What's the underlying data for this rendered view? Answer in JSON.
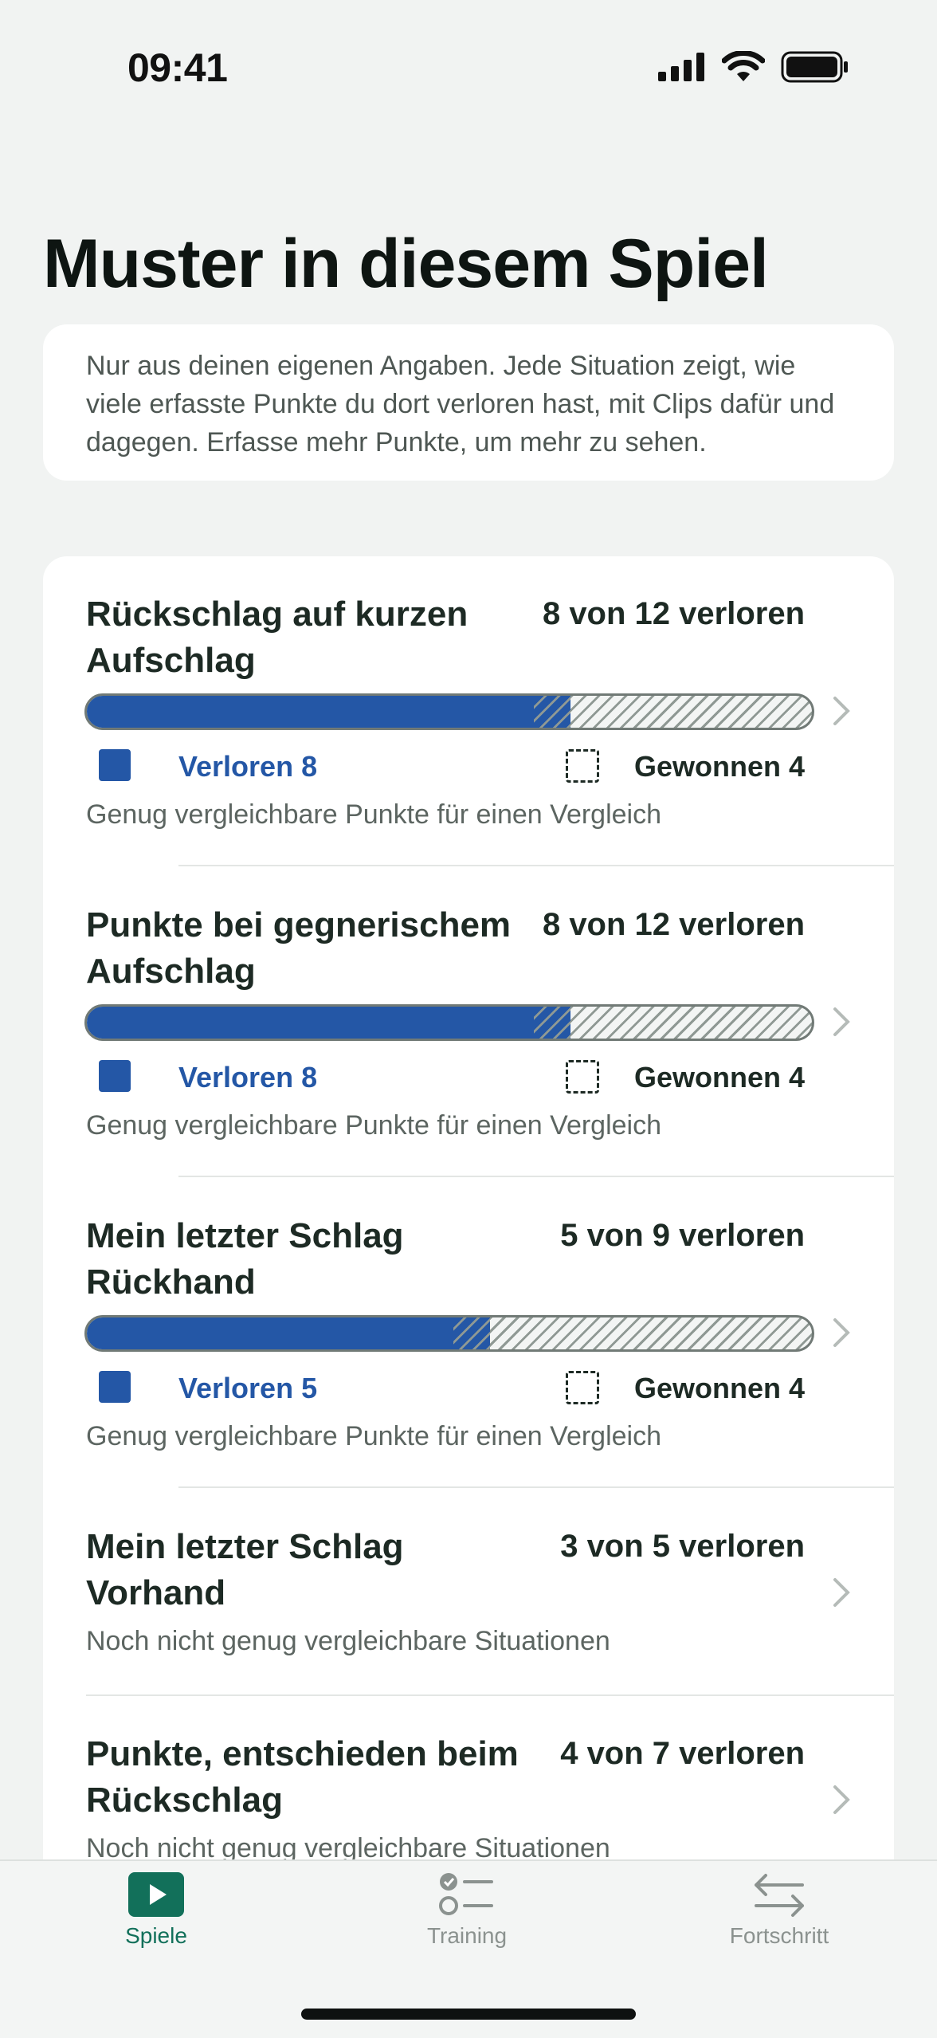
{
  "status_bar": {
    "time": "09:41"
  },
  "page": {
    "title": "Muster in diesem Spiel",
    "info": "Nur aus deinen eigenen Angaben. Jede Situation zeigt, wie viele erfasste Punkte du dort verloren hast, mit Clips dafür und dagegen. Erfasse mehr Punkte, um mehr zu sehen."
  },
  "rows": [
    {
      "title": "Rückschlag auf kurzen Aufschlag",
      "count": "8 von 12 verloren",
      "lost": 8,
      "total": 12,
      "lost_label": "Verloren 8",
      "won_label": "Gewonnen 4",
      "note": "Genug vergleichbare Punkte für einen Vergleich"
    },
    {
      "title": "Punkte bei gegnerischem Aufschlag",
      "count": "8 von 12 verloren",
      "lost": 8,
      "total": 12,
      "lost_label": "Verloren 8",
      "won_label": "Gewonnen 4",
      "note": "Genug vergleichbare Punkte für einen Vergleich"
    },
    {
      "title": "Mein letzter Schlag Rückhand",
      "count": "5 von 9 verloren",
      "lost": 5,
      "total": 9,
      "lost_label": "Verloren 5",
      "won_label": "Gewonnen 4",
      "note": "Genug vergleichbare Punkte für einen Vergleich"
    },
    {
      "title": "Mein letzter Schlag Vorhand",
      "count": "3 von 5 verloren",
      "note": "Noch nicht genug vergleichbare Situationen"
    },
    {
      "title": "Punkte, entschieden beim Rückschlag",
      "count": "4 von 7 verloren",
      "note": "Noch nicht genug vergleichbare Situationen"
    }
  ],
  "tabs": [
    {
      "label": "Spiele",
      "icon": "play-icon",
      "active": true
    },
    {
      "label": "Training",
      "icon": "checklist-icon",
      "active": false
    },
    {
      "label": "Fortschritt",
      "icon": "arrows-swap-icon",
      "active": false
    }
  ],
  "colors": {
    "accent": "#12705A",
    "lost": "#2457A6",
    "background": "#F1F3F2"
  }
}
